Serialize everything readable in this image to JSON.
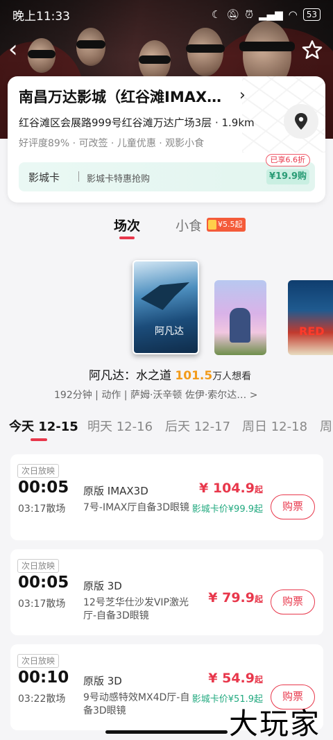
{
  "status_bar": {
    "time": "晚上11:33",
    "battery": "53"
  },
  "cinema": {
    "title": "南昌万达影城（红谷滩IMAX…",
    "address": "红谷滩区会展路999号红谷滩万达广场3层 · 1.9km",
    "tags": "好评度89% · 可改签 · 儿童优惠 · 观影小食",
    "card_label": "影城卡",
    "card_desc": "影城卡特惠抢购",
    "card_price": "¥19.9购",
    "discount_tag": "已享6.6折"
  },
  "tabs": {
    "show": "场次",
    "snack": "小食",
    "snack_badge": "¥5.5起"
  },
  "posters": [
    {
      "text": "阿凡达"
    },
    {
      "text": ""
    },
    {
      "text": "RED"
    }
  ],
  "movie": {
    "name": "阿凡达：水之道",
    "score": "101.5",
    "want": "万人想看",
    "meta": "192分钟 | 动作 | 萨姆·沃辛顿 佐伊·索尔达… >"
  },
  "dates": [
    "今天 12-15",
    "明天 12-16",
    "后天 12-17",
    "周日 12-18",
    "周"
  ],
  "showtimes": [
    {
      "tag": "次日放映",
      "start": "00:05",
      "end": "03:17散场",
      "format": "原版 IMAX3D",
      "hall": "7号-IMAX厅自备3D眼镜",
      "price": "¥ 104.9",
      "price_suffix": "起",
      "card_price": "影城卡价¥99.9起",
      "buy": "购票"
    },
    {
      "tag": "次日放映",
      "start": "00:05",
      "end": "03:17散场",
      "format": "原版 3D",
      "hall": "12号芝华仕沙发VIP激光厅-自备3D眼镜",
      "price": "¥ 79.9",
      "price_suffix": "起",
      "card_price": "",
      "buy": "购票"
    },
    {
      "tag": "次日放映",
      "start": "00:10",
      "end": "03:22散场",
      "format": "原版 3D",
      "hall": "9号动感特效MX4D厅-自备3D眼镜",
      "price": "¥ 54.9",
      "price_suffix": "起",
      "card_price": "影城卡价¥51.9起",
      "buy": "购票"
    }
  ],
  "watermark": "大玩家",
  "colors": {
    "accent": "#e8374b",
    "card_green": "#21a97f",
    "score_orange": "#f29b1b"
  }
}
